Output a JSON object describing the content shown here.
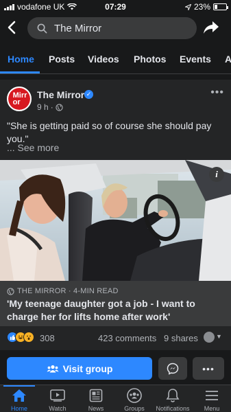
{
  "status_bar": {
    "carrier": "vodafone UK",
    "time": "07:29",
    "battery": "23%",
    "battery_level": 0.23
  },
  "search": {
    "query": "The Mirror"
  },
  "tabs": [
    {
      "label": "Home",
      "active": true
    },
    {
      "label": "Posts"
    },
    {
      "label": "Videos"
    },
    {
      "label": "Photos"
    },
    {
      "label": "Events"
    },
    {
      "label": "A"
    }
  ],
  "post": {
    "avatar_text": "Mirr or",
    "page_name": "The Mirror",
    "time": "9 h",
    "caption": "\"She is getting paid so of course she should pay you.\"",
    "see_more": "... See more",
    "link": {
      "source": "THE MIRROR · 4-MIN READ",
      "headline": "'My teenage daughter got a job - I want to charge her for lifts home after work'"
    },
    "reaction_count": "308",
    "comments": "423 comments",
    "shares": "9 shares"
  },
  "actions": {
    "visit_label": "Visit group"
  },
  "bottom_nav": [
    {
      "label": "Home",
      "icon": "home-icon",
      "active": true
    },
    {
      "label": "Watch",
      "icon": "watch-icon"
    },
    {
      "label": "News",
      "icon": "news-icon"
    },
    {
      "label": "Groups",
      "icon": "groups-icon"
    },
    {
      "label": "Notifications",
      "icon": "bell-icon"
    },
    {
      "label": "Menu",
      "icon": "menu-icon"
    }
  ],
  "colors": {
    "accent": "#2d88ff",
    "background": "#18191a",
    "card": "#242526",
    "brand_red": "#d71920"
  }
}
